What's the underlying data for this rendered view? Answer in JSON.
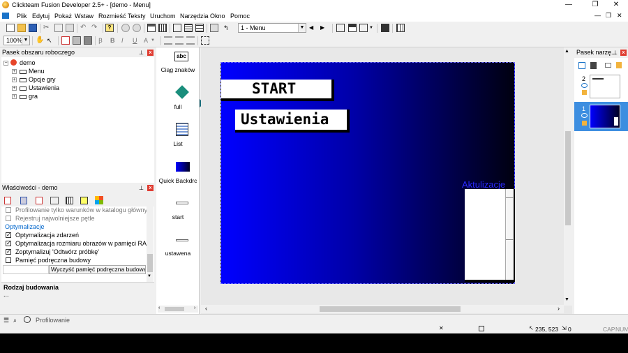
{
  "window": {
    "title": "Clickteam Fusion Developer 2.5+ - [demo - Menu]",
    "controls": {
      "minimize": "—",
      "maximize": "❐",
      "close": "✕"
    }
  },
  "menu": [
    "Plik",
    "Edytuj",
    "Pokaż",
    "Wstaw",
    "Rozmieść",
    "Teksty",
    "Uruchom",
    "Narzędzia",
    "Okno",
    "Pomoc"
  ],
  "toolbar": {
    "frame_select": "1 - Menu",
    "zoom": "100%"
  },
  "workspace": {
    "title": "Pasek obszaru roboczego",
    "root": "demo",
    "frames": [
      "Menu",
      "Opcje gry",
      "Ustawienia",
      "gra"
    ]
  },
  "properties": {
    "title": "Właściwości - demo",
    "rows": [
      {
        "label": "Profilowanie tylko warunków w katalogu głównym",
        "checked": false,
        "disabled": true
      },
      {
        "label": "Rejestruj najwolniejsze pętle",
        "checked": false,
        "disabled": true
      }
    ],
    "section": "Optymalizacje",
    "opt_rows": [
      {
        "label": "Optymalizacja zdarzeń",
        "checked": true
      },
      {
        "label": "Optymalizacja rozmiaru obrazów w pamięci RAM",
        "checked": true
      },
      {
        "label": "Zoptymalizuj 'Odtwórz próbkę'",
        "checked": true
      },
      {
        "label": "Pamięć podręczna budowy",
        "checked": false
      }
    ],
    "clear_cache_button": "Wyczyść pamięć podręczna budowania",
    "desc_title": "Rodzaj budowania",
    "desc_text": "..."
  },
  "object_library": [
    {
      "label": "Ciąg znaków",
      "icon": "string-icon"
    },
    {
      "label": "full",
      "icon": "diamond-icon"
    },
    {
      "label": "List",
      "icon": "list-icon"
    },
    {
      "label": "Quick Backdrc",
      "icon": "backdrop-icon"
    },
    {
      "label": "start",
      "icon": "small-button-icon"
    },
    {
      "label": "ustawena",
      "icon": "small-button-icon"
    }
  ],
  "frame": {
    "buttons": [
      "START",
      "Ustawienia"
    ],
    "aktualizacje": "Aktulizacje"
  },
  "layers_panel": {
    "title": "Pasek narzę...",
    "layers": [
      {
        "number": "2"
      },
      {
        "number": "1"
      }
    ]
  },
  "statusbar": {
    "tab": "Profilowanie",
    "coords": "235, 523",
    "zero": "0",
    "caps": "CAP",
    "num": "NUM"
  },
  "colors": {
    "frame_blue": "#0000ff",
    "accent": "#0066cc",
    "close_red": "#e03c31",
    "aktualizacje_color": "#2a2aff"
  }
}
